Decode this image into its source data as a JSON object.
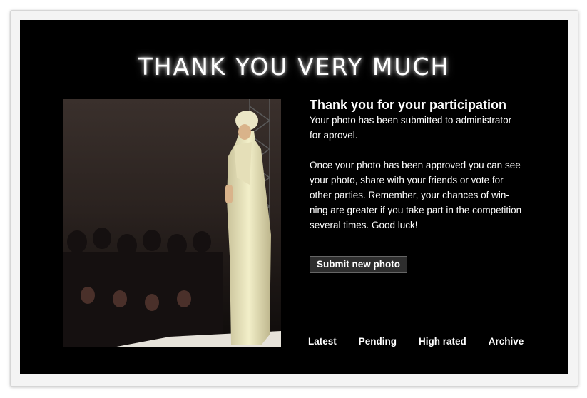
{
  "page": {
    "headline": "THANK YOU VERY MUCH"
  },
  "content": {
    "title": "Thank you for your participation",
    "paragraph1_line1": "Your photo has been submitted to administrator",
    "paragraph1_line2": "for aprovel.",
    "paragraph2_line1": "Once your photo has been approved you can see",
    "paragraph2_line2": "your photo, share with your friends or vote for",
    "paragraph2_line3": "other parties. Remember, your chances of win-",
    "paragraph2_line4": "ning are greater if you take part in the competition",
    "paragraph2_line5": "several times. Good luck!"
  },
  "actions": {
    "submit_label": "Submit new photo"
  },
  "nav": {
    "items": [
      {
        "label": "Latest"
      },
      {
        "label": "Pending"
      },
      {
        "label": "High rated"
      },
      {
        "label": "Archive"
      }
    ]
  },
  "colors": {
    "panel_background": "#000000",
    "frame_background": "#f4f4f4",
    "text": "#ffffff",
    "button_background": "#2e2e2e"
  },
  "image": {
    "subject": "fashion runway photo - model in white outfit and hat"
  }
}
